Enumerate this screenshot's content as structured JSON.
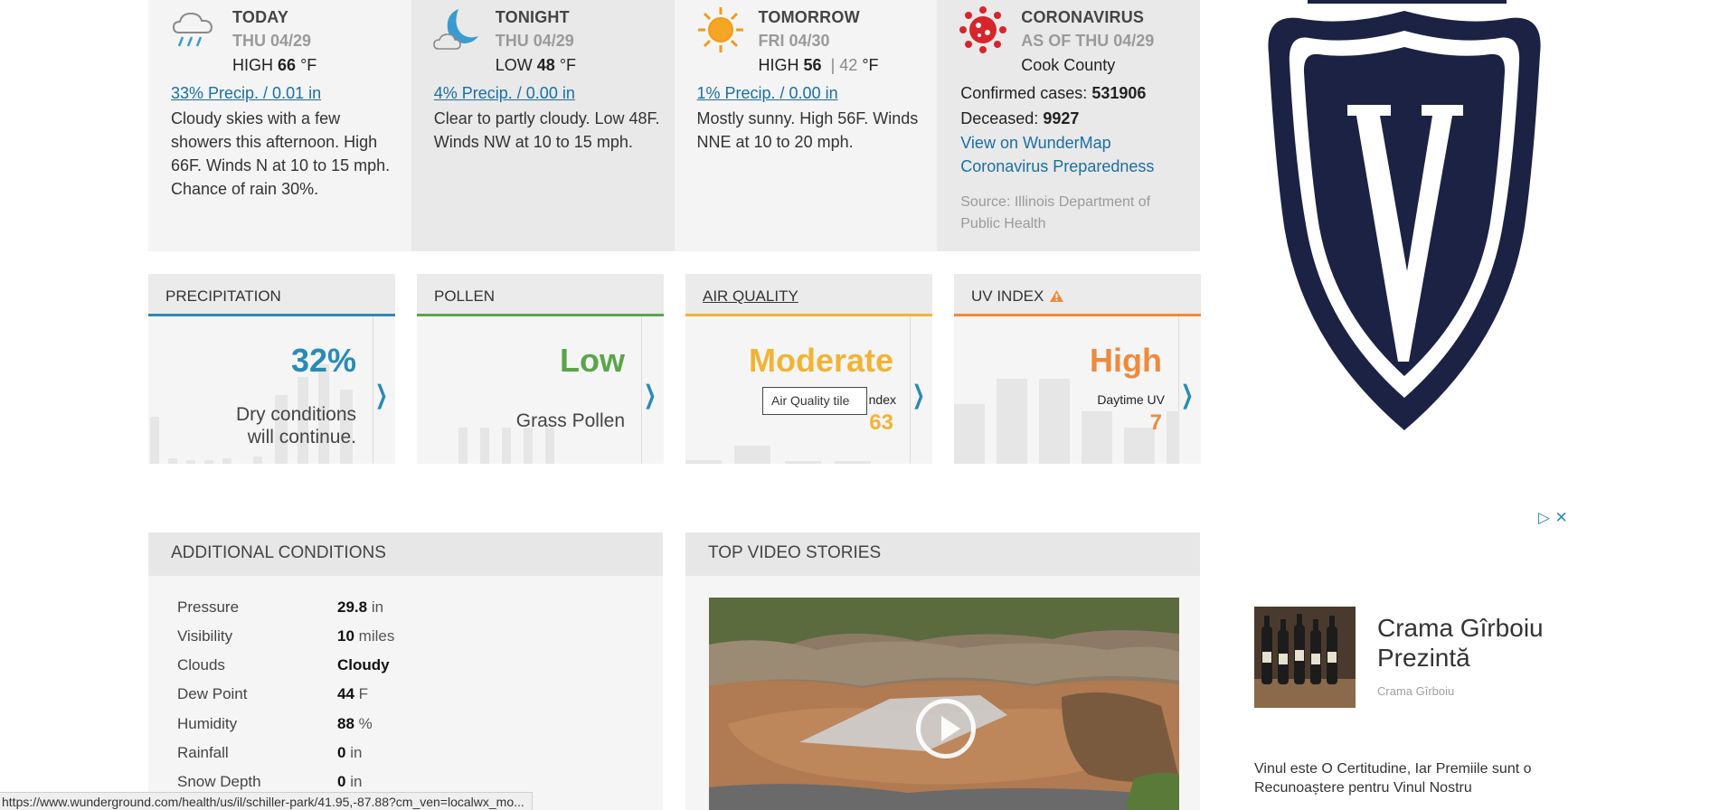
{
  "forecast": [
    {
      "title": "TODAY",
      "date": "THU 04/29",
      "temp_label": "HIGH",
      "temp": "66",
      "unit": "°F",
      "precip": "33% Precip. / 0.01 in",
      "desc": "Cloudy skies with a few showers this afternoon. High 66F. Winds N at 10 to 15 mph. Chance of rain 30%.",
      "icon": "rain-cloud-icon"
    },
    {
      "title": "TONIGHT",
      "date": "THU 04/29",
      "temp_label": "LOW",
      "temp": "48",
      "unit": "°F",
      "precip": "4% Precip. / 0.00 in",
      "desc": "Clear to partly cloudy. Low 48F. Winds NW at 10 to 15 mph.",
      "icon": "moon-cloud-icon"
    },
    {
      "title": "TOMORROW",
      "date": "FRI 04/30",
      "temp_label": "HIGH",
      "temp": "56",
      "sep": "|",
      "low": "42",
      "unit": "°F",
      "precip": "1% Precip. / 0.00 in",
      "desc": "Mostly sunny. High 56F. Winds NNE at 10 to 20 mph.",
      "icon": "sun-icon"
    }
  ],
  "coronavirus": {
    "title": "CORONAVIRUS",
    "as_of": "AS OF THU 04/29",
    "county": "Cook County",
    "confirmed_label": "Confirmed cases:",
    "confirmed": "531906",
    "deceased_label": "Deceased:",
    "deceased": "9927",
    "map_link": "View on WunderMap",
    "prep_link": "Coronavirus Preparedness",
    "source": "Source: Illinois Department of Public Health",
    "icon": "virus-icon",
    "color": "#d6262b"
  },
  "tiles": {
    "precipitation": {
      "title": "PRECIPITATION",
      "value": "32%",
      "line1": "Dry conditions",
      "line2": "will continue.",
      "color": "#2a8ab7"
    },
    "pollen": {
      "title": "POLLEN",
      "value": "Low",
      "desc": "Grass Pollen",
      "color": "#5aa54a"
    },
    "air_quality": {
      "title": "AIR QUALITY",
      "value": "Moderate",
      "label": "ndex",
      "index": "63",
      "color": "#f2b335"
    },
    "uv_index": {
      "title": "UV INDEX",
      "value": "High",
      "label": "Daytime UV",
      "index": "7",
      "color": "#ee8a3c",
      "alert_icon": "warning-icon"
    }
  },
  "tooltip": "Air Quality tile",
  "additional": {
    "title": "ADDITIONAL CONDITIONS",
    "rows": [
      {
        "label": "Pressure",
        "value": "29.8",
        "unit": "in"
      },
      {
        "label": "Visibility",
        "value": "10",
        "unit": "miles"
      },
      {
        "label": "Clouds",
        "value": "Cloudy",
        "unit": ""
      },
      {
        "label": "Dew Point",
        "value": "44",
        "unit": "F"
      },
      {
        "label": "Humidity",
        "value": "88",
        "unit": "%"
      },
      {
        "label": "Rainfall",
        "value": "0",
        "unit": "in"
      },
      {
        "label": "Snow Depth",
        "value": "0",
        "unit": "in"
      }
    ]
  },
  "videos": {
    "title": "TOP VIDEO STORIES"
  },
  "ad": {
    "title": "Crama Gîrboiu Prezintă",
    "brand": "Crama Gîrboiu",
    "text": "Vinul este O Certitudine, Iar Premiile sunt o Recunoaștere pentru Vinul Nostru"
  },
  "status_url": "https://www.wunderground.com/health/us/il/schiller-park/41.95,-87.88?cm_ven=localwx_mo..."
}
